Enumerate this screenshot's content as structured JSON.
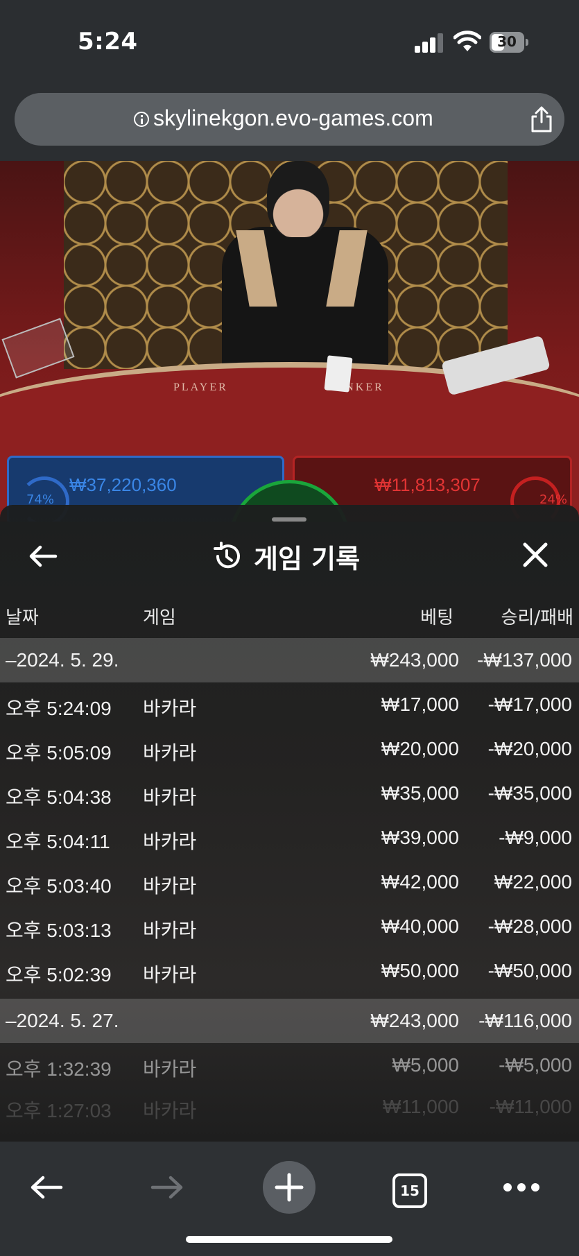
{
  "status_bar": {
    "time": "5:24",
    "battery": "30"
  },
  "browser": {
    "url": "skylinekgon.evo-games.com",
    "tab_count": "15"
  },
  "game_scene": {
    "table_labels": [
      "PLAYER",
      "BANKER"
    ],
    "player": {
      "amount": "₩37,220,360",
      "percent": "74%"
    },
    "banker": {
      "amount": "₩11,813,307",
      "percent": "24%"
    }
  },
  "panel": {
    "title": "게임 기록",
    "columns": {
      "date": "날짜",
      "game": "게임",
      "bet": "베팅",
      "result": "승리/패배"
    },
    "groups": [
      {
        "date": "–2024. 5. 29.",
        "bet": "₩243,000",
        "result": "-₩137,000",
        "rows": [
          {
            "time": "오후 5:24:09",
            "game": "바카라",
            "bet": "₩17,000",
            "result": "-₩17,000"
          },
          {
            "time": "오후 5:05:09",
            "game": "바카라",
            "bet": "₩20,000",
            "result": "-₩20,000"
          },
          {
            "time": "오후 5:04:38",
            "game": "바카라",
            "bet": "₩35,000",
            "result": "-₩35,000"
          },
          {
            "time": "오후 5:04:11",
            "game": "바카라",
            "bet": "₩39,000",
            "result": "-₩9,000"
          },
          {
            "time": "오후 5:03:40",
            "game": "바카라",
            "bet": "₩42,000",
            "result": "₩22,000"
          },
          {
            "time": "오후 5:03:13",
            "game": "바카라",
            "bet": "₩40,000",
            "result": "-₩28,000"
          },
          {
            "time": "오후 5:02:39",
            "game": "바카라",
            "bet": "₩50,000",
            "result": "-₩50,000"
          }
        ]
      },
      {
        "date": "–2024. 5. 27.",
        "bet": "₩243,000",
        "result": "-₩116,000",
        "rows": [
          {
            "time": "오후 1:32:39",
            "game": "바카라",
            "bet": "₩5,000",
            "result": "-₩5,000"
          },
          {
            "time": "오후 1:27:03",
            "game": "바카라",
            "bet": "₩11,000",
            "result": "-₩11,000"
          }
        ]
      }
    ]
  },
  "icons": {
    "back": "arrow-left-icon",
    "close": "close-icon",
    "history": "history-icon",
    "share": "share-icon",
    "info": "info-icon"
  }
}
